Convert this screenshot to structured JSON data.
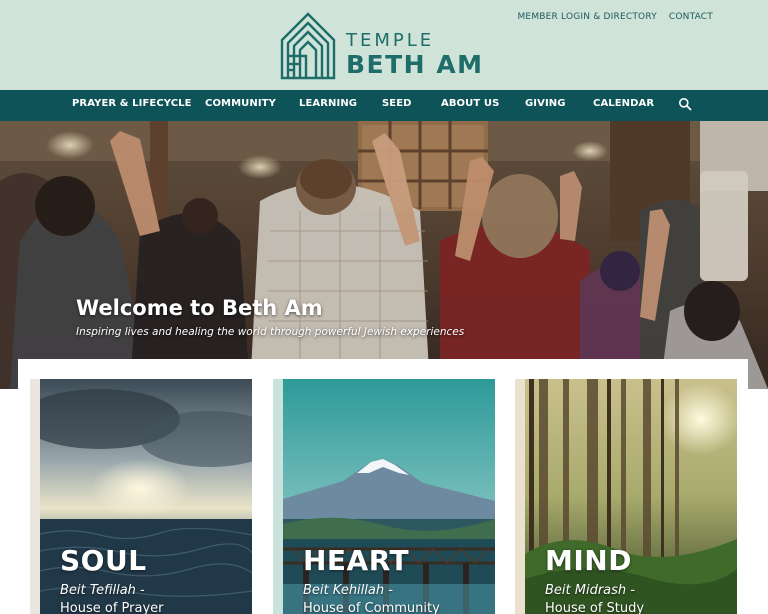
{
  "top_links": {
    "member_login": "MEMBER LOGIN & DIRECTORY",
    "contact": "CONTACT"
  },
  "logo": {
    "line1": "TEMPLE",
    "line2": "BETH AM",
    "icon": "house-logo-icon"
  },
  "nav": {
    "items": [
      "PRAYER & LIFECYCLE",
      "COMMUNITY",
      "LEARNING",
      "SEED",
      "ABOUT US",
      "GIVING",
      "CALENDAR"
    ],
    "search_icon": "search-icon"
  },
  "hero": {
    "title": "Welcome to Beth Am",
    "subtitle": "Inspiring lives and healing the world through powerful Jewish experiences"
  },
  "cards": [
    {
      "title": "SOUL",
      "subtitle": "Beit Tefillah -",
      "subtitle2": "House of Prayer"
    },
    {
      "title": "HEART",
      "subtitle": "Beit Kehillah -",
      "subtitle2": "House of Community"
    },
    {
      "title": "MIND",
      "subtitle": "Beit Midrash -",
      "subtitle2": "House of Study"
    }
  ],
  "colors": {
    "header_bg": "#cfe3d9",
    "nav_bg": "#0e5357",
    "brand": "#1f6d6a"
  }
}
